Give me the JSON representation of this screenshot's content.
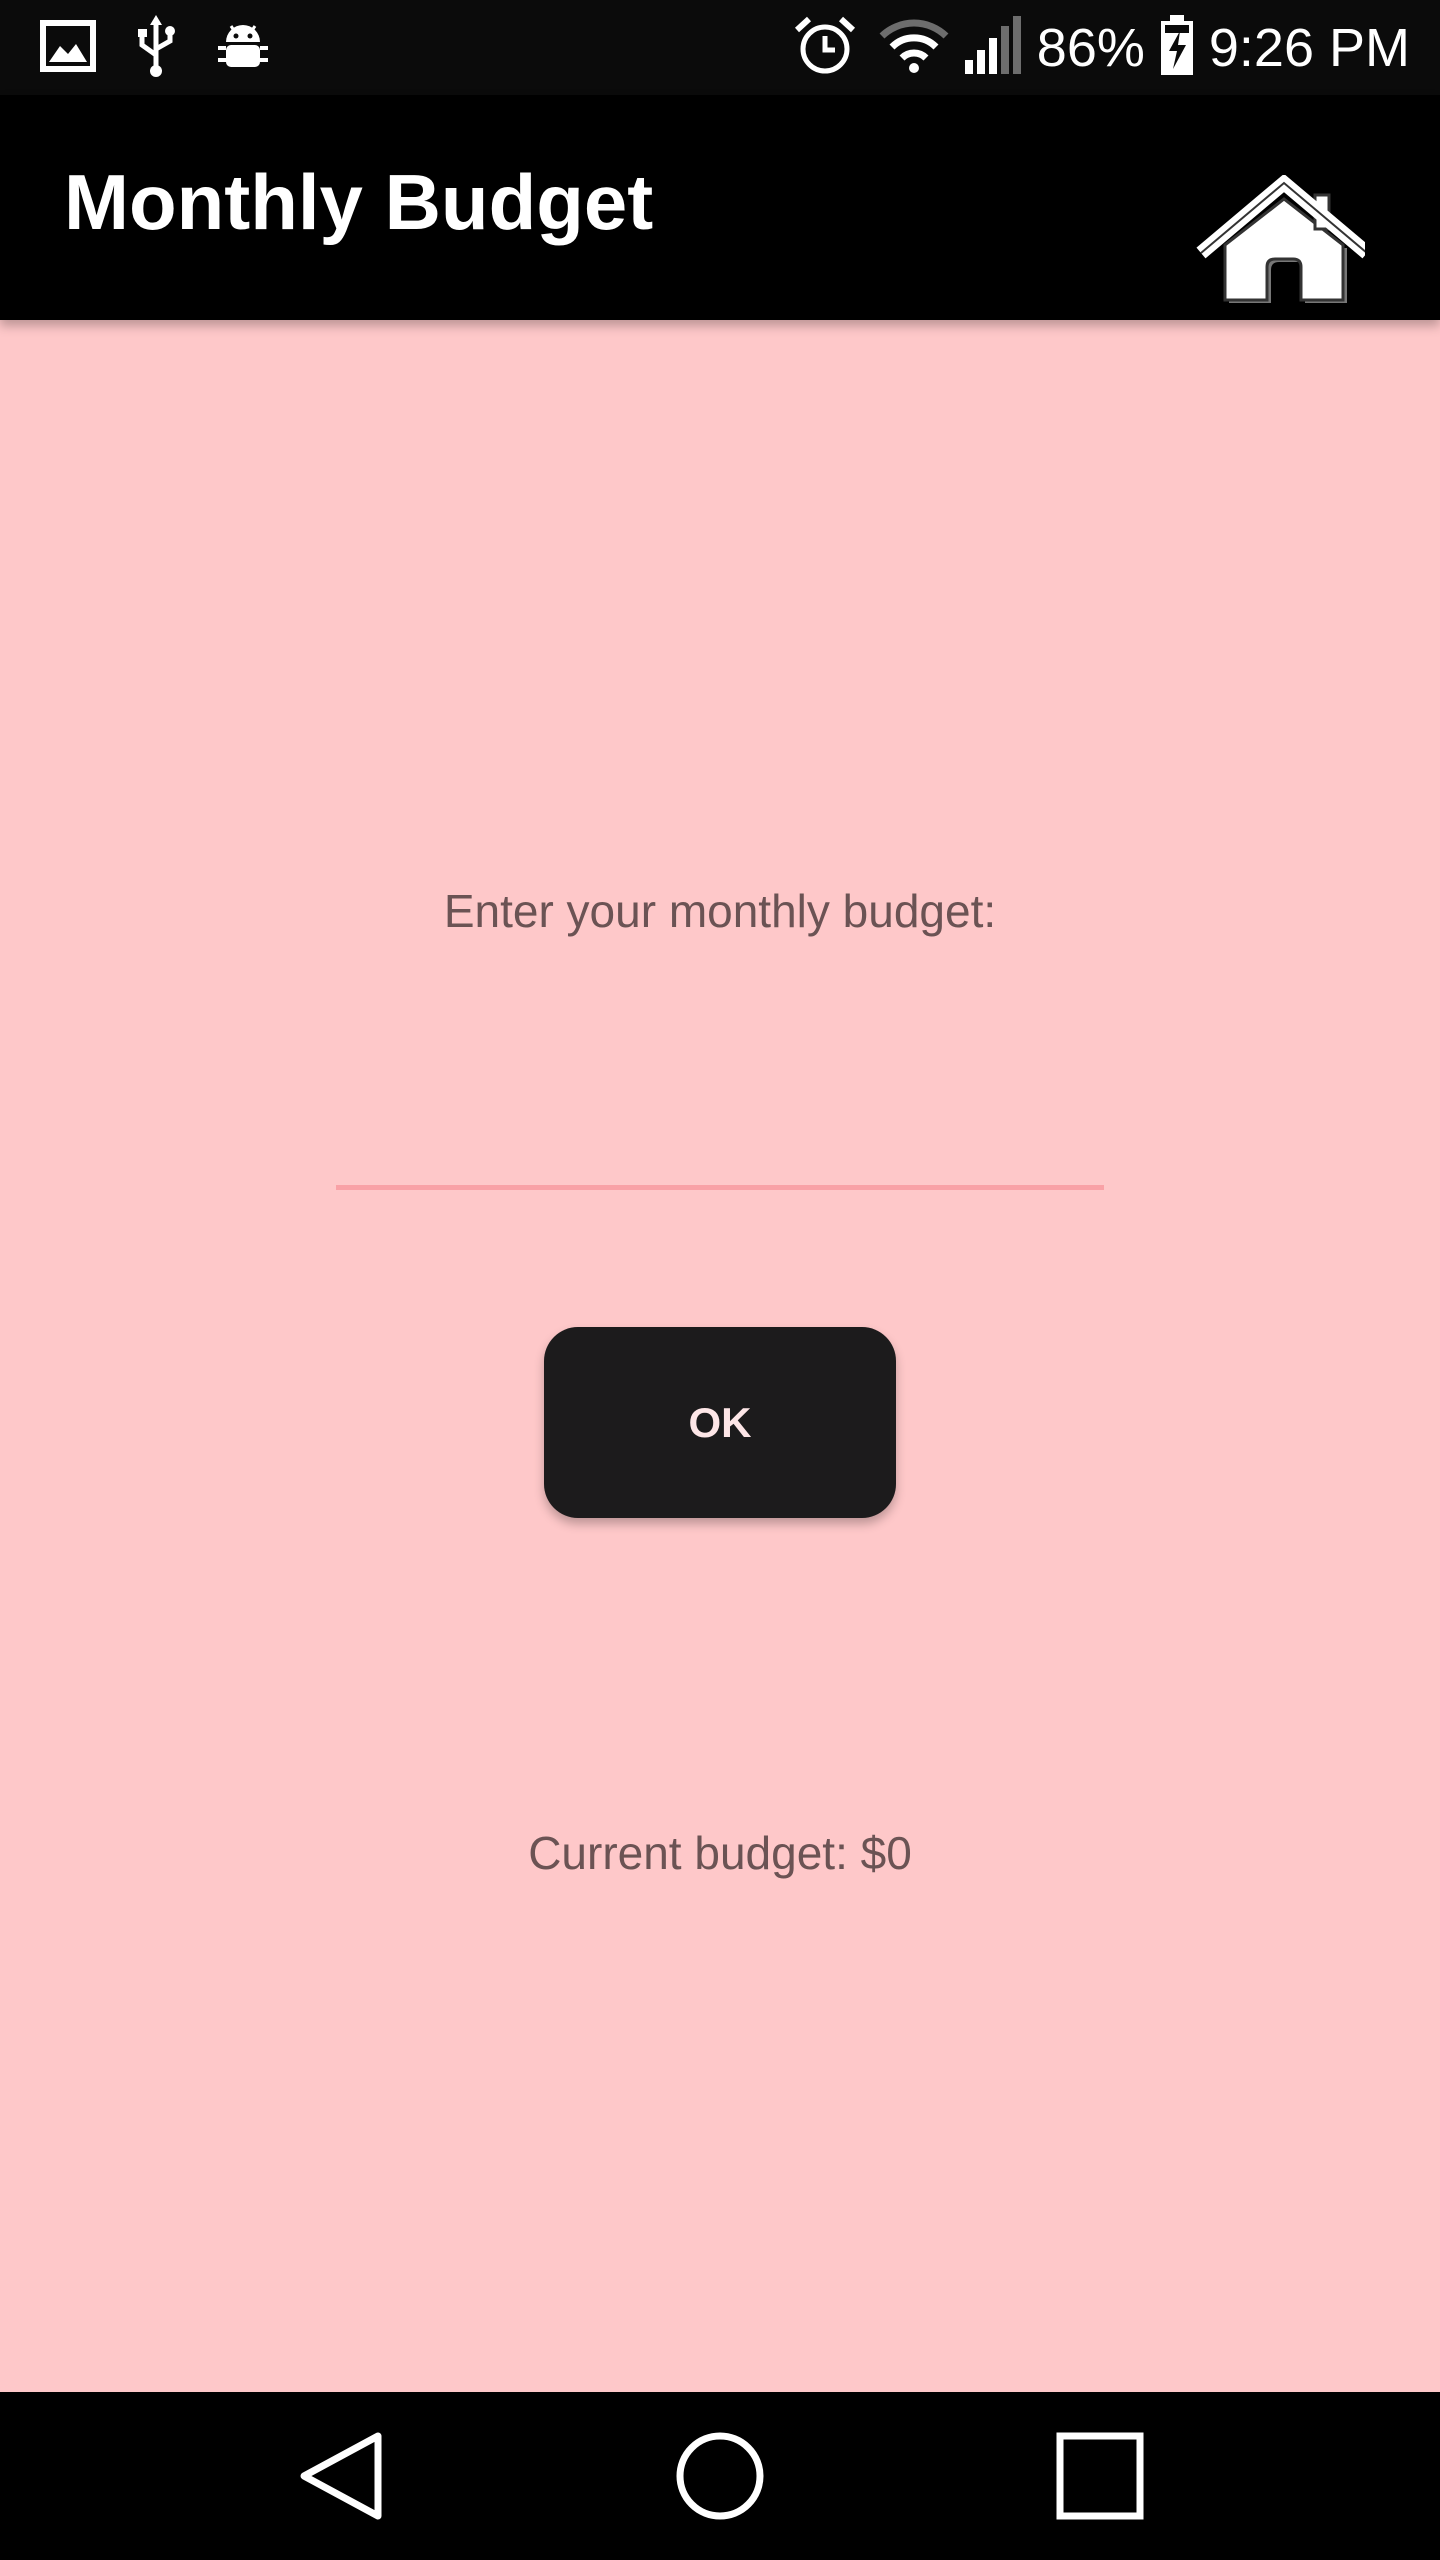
{
  "status_bar": {
    "icons_left": [
      "gallery-icon",
      "usb-icon",
      "android-debug-icon"
    ],
    "icons_right": [
      "alarm-icon",
      "wifi-icon",
      "signal-icon"
    ],
    "battery_percent": "86%",
    "battery_icon": "battery-charging-icon",
    "time": "9:26 PM"
  },
  "app_bar": {
    "title": "Monthly Budget",
    "home_icon": "home-icon"
  },
  "form": {
    "prompt": "Enter your monthly budget:",
    "input_value": "",
    "ok_label": "OK",
    "current_budget": "Current budget: $0"
  },
  "nav_bar": {
    "back_icon": "back-triangle-icon",
    "home_icon": "home-circle-icon",
    "recents_icon": "recents-square-icon"
  },
  "colors": {
    "background": "#fec8c9",
    "app_bar": "#000000",
    "button": "#1c1b1c",
    "input_underline": "#f9a1a6",
    "label_text": "#6b5354"
  }
}
